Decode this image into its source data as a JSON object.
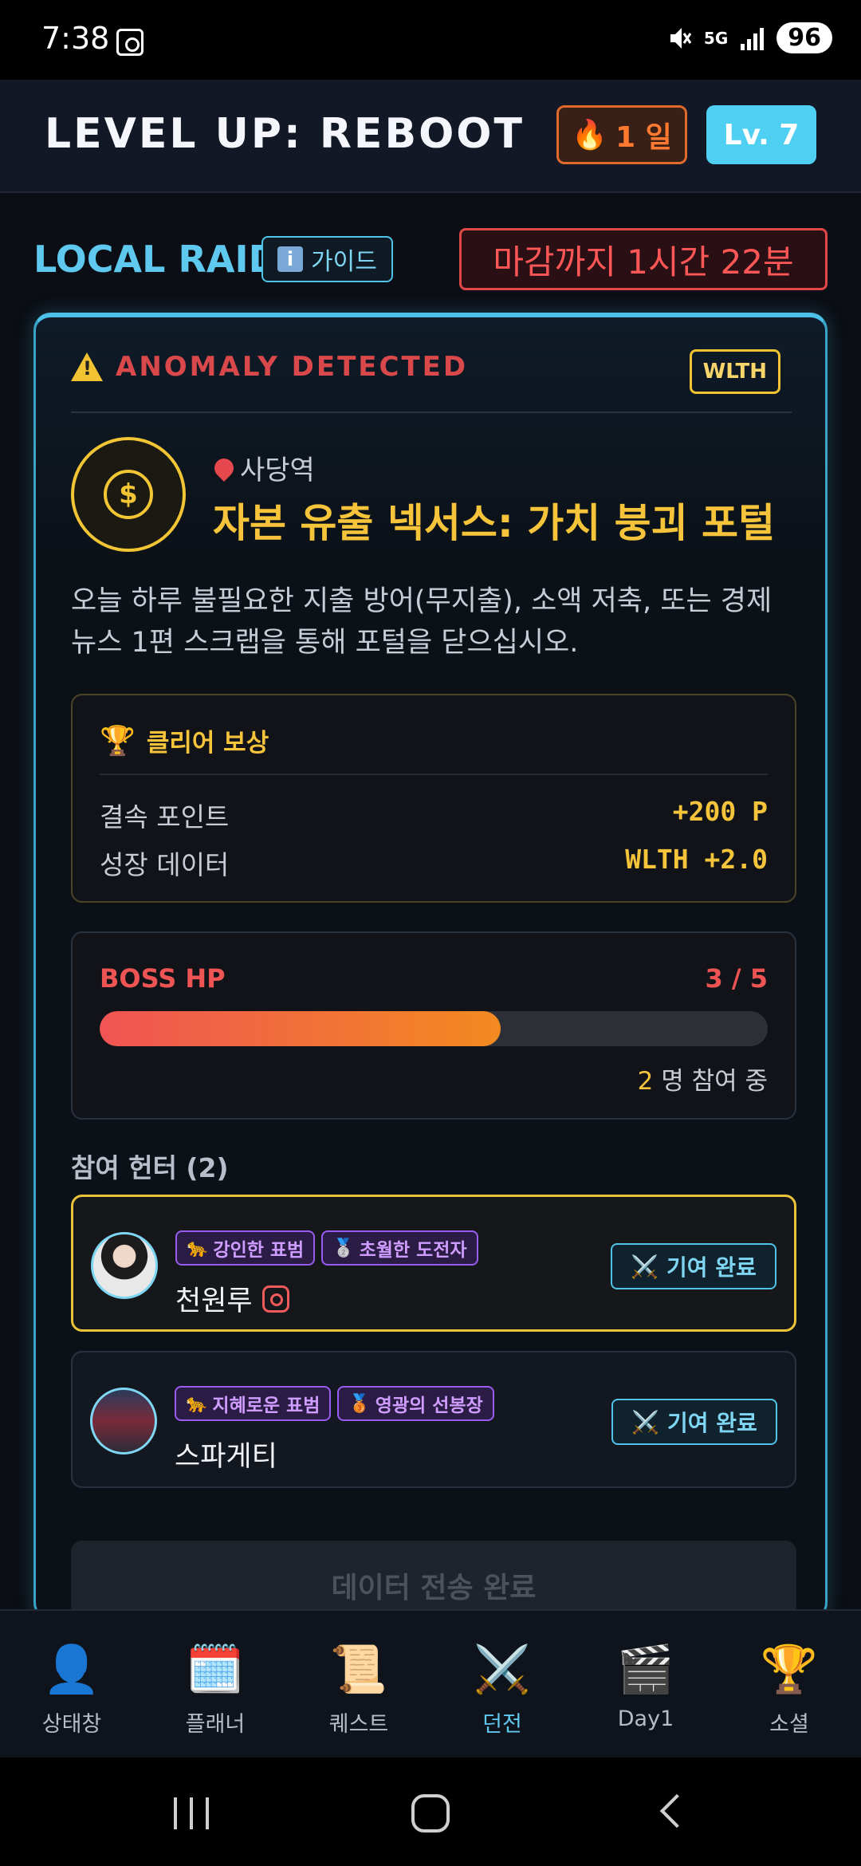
{
  "status_bar": {
    "time": "7:38",
    "network": "5G",
    "battery": "96"
  },
  "header": {
    "app_title": "LEVEL UP: REBOOT",
    "streak_icon": "fire-icon",
    "streak": "1 일",
    "level": "Lv. 7"
  },
  "raid": {
    "section_title": "LOCAL RAID",
    "guide_label": "가이드",
    "deadline": "마감까지  1시간  22분",
    "anomaly_label": "ANOMALY DETECTED",
    "category_tag": "WLTH",
    "location": "사당역",
    "boss_name": "자본 유출 넥서스: 가치 붕괴 포털",
    "description": "오늘 하루 불필요한 지출 방어(무지출), 소액 저축, 또는 경제 뉴스 1편 스크랩을 통해 포털을 닫으십시오.",
    "reward": {
      "title": "클리어 보상",
      "rows": [
        {
          "label": "결속 포인트",
          "value": "+200 P"
        },
        {
          "label": "성장 데이터",
          "value": "WLTH +2.0"
        }
      ]
    },
    "boss_hp": {
      "label": "BOSS HP",
      "count": "3 / 5",
      "fill_fraction": 0.6,
      "participants_count": "2",
      "participants_suffix": " 명 참여 중"
    },
    "hunters_title": "참여 헌터 (2)",
    "hunters": [
      {
        "name": "천원루",
        "badges": [
          {
            "icon": "🐆",
            "label": "강인한 표범"
          },
          {
            "icon": "🥈",
            "label": "초월한 도전자"
          }
        ],
        "action": "기여 완료",
        "has_instagram": true
      },
      {
        "name": "스파게티",
        "badges": [
          {
            "icon": "🐆",
            "label": "지혜로운 표범"
          },
          {
            "icon": "🥉",
            "label": "영광의 선봉장"
          }
        ],
        "action": "기여 완료",
        "has_instagram": false
      }
    ],
    "submit_label": "데이터 전송 완료"
  },
  "bottom_nav": [
    {
      "icon": "👤",
      "label": "상태창"
    },
    {
      "icon": "🗓️",
      "label": "플래너"
    },
    {
      "icon": "📜",
      "label": "퀘스트"
    },
    {
      "icon": "⚔️",
      "label": "던전"
    },
    {
      "icon": "🎬",
      "label": "Day1"
    },
    {
      "icon": "🏆",
      "label": "소셜"
    }
  ],
  "active_nav": "던전",
  "colors": {
    "accent": "#4fd0f2",
    "gold": "#f6c43a",
    "danger": "#ee5454"
  }
}
